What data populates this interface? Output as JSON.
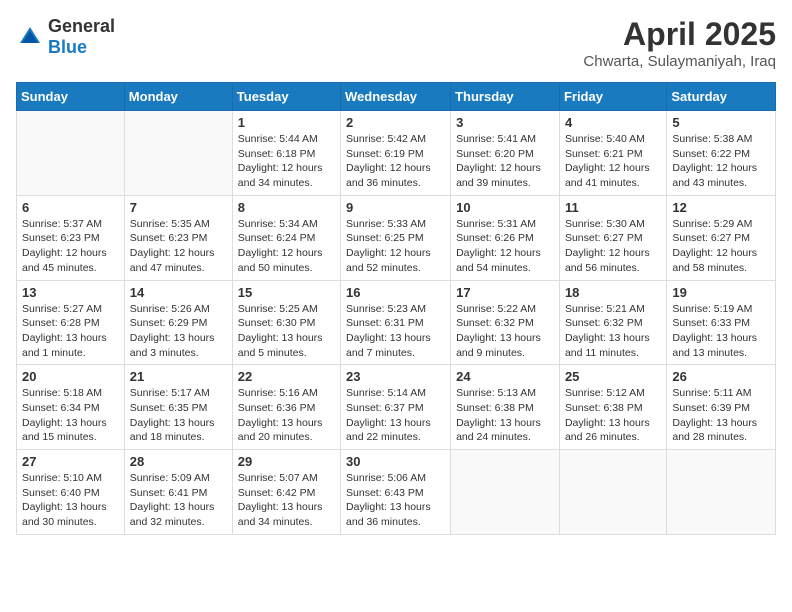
{
  "header": {
    "logo": {
      "text_general": "General",
      "text_blue": "Blue"
    },
    "title": "April 2025",
    "subtitle": "Chwarta, Sulaymaniyah, Iraq"
  },
  "weekdays": [
    "Sunday",
    "Monday",
    "Tuesday",
    "Wednesday",
    "Thursday",
    "Friday",
    "Saturday"
  ],
  "weeks": [
    [
      {
        "day": "",
        "sunrise": "",
        "sunset": "",
        "daylight": "",
        "empty": true
      },
      {
        "day": "",
        "sunrise": "",
        "sunset": "",
        "daylight": "",
        "empty": true
      },
      {
        "day": "1",
        "sunrise": "Sunrise: 5:44 AM",
        "sunset": "Sunset: 6:18 PM",
        "daylight": "Daylight: 12 hours and 34 minutes.",
        "empty": false
      },
      {
        "day": "2",
        "sunrise": "Sunrise: 5:42 AM",
        "sunset": "Sunset: 6:19 PM",
        "daylight": "Daylight: 12 hours and 36 minutes.",
        "empty": false
      },
      {
        "day": "3",
        "sunrise": "Sunrise: 5:41 AM",
        "sunset": "Sunset: 6:20 PM",
        "daylight": "Daylight: 12 hours and 39 minutes.",
        "empty": false
      },
      {
        "day": "4",
        "sunrise": "Sunrise: 5:40 AM",
        "sunset": "Sunset: 6:21 PM",
        "daylight": "Daylight: 12 hours and 41 minutes.",
        "empty": false
      },
      {
        "day": "5",
        "sunrise": "Sunrise: 5:38 AM",
        "sunset": "Sunset: 6:22 PM",
        "daylight": "Daylight: 12 hours and 43 minutes.",
        "empty": false
      }
    ],
    [
      {
        "day": "6",
        "sunrise": "Sunrise: 5:37 AM",
        "sunset": "Sunset: 6:23 PM",
        "daylight": "Daylight: 12 hours and 45 minutes.",
        "empty": false
      },
      {
        "day": "7",
        "sunrise": "Sunrise: 5:35 AM",
        "sunset": "Sunset: 6:23 PM",
        "daylight": "Daylight: 12 hours and 47 minutes.",
        "empty": false
      },
      {
        "day": "8",
        "sunrise": "Sunrise: 5:34 AM",
        "sunset": "Sunset: 6:24 PM",
        "daylight": "Daylight: 12 hours and 50 minutes.",
        "empty": false
      },
      {
        "day": "9",
        "sunrise": "Sunrise: 5:33 AM",
        "sunset": "Sunset: 6:25 PM",
        "daylight": "Daylight: 12 hours and 52 minutes.",
        "empty": false
      },
      {
        "day": "10",
        "sunrise": "Sunrise: 5:31 AM",
        "sunset": "Sunset: 6:26 PM",
        "daylight": "Daylight: 12 hours and 54 minutes.",
        "empty": false
      },
      {
        "day": "11",
        "sunrise": "Sunrise: 5:30 AM",
        "sunset": "Sunset: 6:27 PM",
        "daylight": "Daylight: 12 hours and 56 minutes.",
        "empty": false
      },
      {
        "day": "12",
        "sunrise": "Sunrise: 5:29 AM",
        "sunset": "Sunset: 6:27 PM",
        "daylight": "Daylight: 12 hours and 58 minutes.",
        "empty": false
      }
    ],
    [
      {
        "day": "13",
        "sunrise": "Sunrise: 5:27 AM",
        "sunset": "Sunset: 6:28 PM",
        "daylight": "Daylight: 13 hours and 1 minute.",
        "empty": false
      },
      {
        "day": "14",
        "sunrise": "Sunrise: 5:26 AM",
        "sunset": "Sunset: 6:29 PM",
        "daylight": "Daylight: 13 hours and 3 minutes.",
        "empty": false
      },
      {
        "day": "15",
        "sunrise": "Sunrise: 5:25 AM",
        "sunset": "Sunset: 6:30 PM",
        "daylight": "Daylight: 13 hours and 5 minutes.",
        "empty": false
      },
      {
        "day": "16",
        "sunrise": "Sunrise: 5:23 AM",
        "sunset": "Sunset: 6:31 PM",
        "daylight": "Daylight: 13 hours and 7 minutes.",
        "empty": false
      },
      {
        "day": "17",
        "sunrise": "Sunrise: 5:22 AM",
        "sunset": "Sunset: 6:32 PM",
        "daylight": "Daylight: 13 hours and 9 minutes.",
        "empty": false
      },
      {
        "day": "18",
        "sunrise": "Sunrise: 5:21 AM",
        "sunset": "Sunset: 6:32 PM",
        "daylight": "Daylight: 13 hours and 11 minutes.",
        "empty": false
      },
      {
        "day": "19",
        "sunrise": "Sunrise: 5:19 AM",
        "sunset": "Sunset: 6:33 PM",
        "daylight": "Daylight: 13 hours and 13 minutes.",
        "empty": false
      }
    ],
    [
      {
        "day": "20",
        "sunrise": "Sunrise: 5:18 AM",
        "sunset": "Sunset: 6:34 PM",
        "daylight": "Daylight: 13 hours and 15 minutes.",
        "empty": false
      },
      {
        "day": "21",
        "sunrise": "Sunrise: 5:17 AM",
        "sunset": "Sunset: 6:35 PM",
        "daylight": "Daylight: 13 hours and 18 minutes.",
        "empty": false
      },
      {
        "day": "22",
        "sunrise": "Sunrise: 5:16 AM",
        "sunset": "Sunset: 6:36 PM",
        "daylight": "Daylight: 13 hours and 20 minutes.",
        "empty": false
      },
      {
        "day": "23",
        "sunrise": "Sunrise: 5:14 AM",
        "sunset": "Sunset: 6:37 PM",
        "daylight": "Daylight: 13 hours and 22 minutes.",
        "empty": false
      },
      {
        "day": "24",
        "sunrise": "Sunrise: 5:13 AM",
        "sunset": "Sunset: 6:38 PM",
        "daylight": "Daylight: 13 hours and 24 minutes.",
        "empty": false
      },
      {
        "day": "25",
        "sunrise": "Sunrise: 5:12 AM",
        "sunset": "Sunset: 6:38 PM",
        "daylight": "Daylight: 13 hours and 26 minutes.",
        "empty": false
      },
      {
        "day": "26",
        "sunrise": "Sunrise: 5:11 AM",
        "sunset": "Sunset: 6:39 PM",
        "daylight": "Daylight: 13 hours and 28 minutes.",
        "empty": false
      }
    ],
    [
      {
        "day": "27",
        "sunrise": "Sunrise: 5:10 AM",
        "sunset": "Sunset: 6:40 PM",
        "daylight": "Daylight: 13 hours and 30 minutes.",
        "empty": false
      },
      {
        "day": "28",
        "sunrise": "Sunrise: 5:09 AM",
        "sunset": "Sunset: 6:41 PM",
        "daylight": "Daylight: 13 hours and 32 minutes.",
        "empty": false
      },
      {
        "day": "29",
        "sunrise": "Sunrise: 5:07 AM",
        "sunset": "Sunset: 6:42 PM",
        "daylight": "Daylight: 13 hours and 34 minutes.",
        "empty": false
      },
      {
        "day": "30",
        "sunrise": "Sunrise: 5:06 AM",
        "sunset": "Sunset: 6:43 PM",
        "daylight": "Daylight: 13 hours and 36 minutes.",
        "empty": false
      },
      {
        "day": "",
        "sunrise": "",
        "sunset": "",
        "daylight": "",
        "empty": true
      },
      {
        "day": "",
        "sunrise": "",
        "sunset": "",
        "daylight": "",
        "empty": true
      },
      {
        "day": "",
        "sunrise": "",
        "sunset": "",
        "daylight": "",
        "empty": true
      }
    ]
  ]
}
